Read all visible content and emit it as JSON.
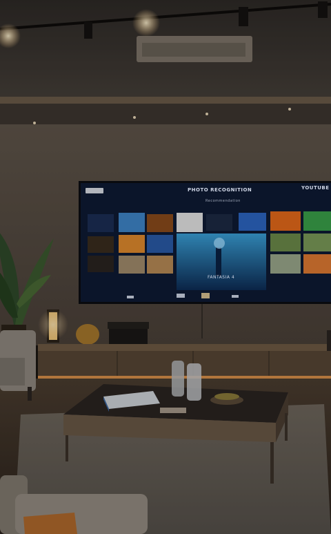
{
  "tv": {
    "brand_text": "PHOTO RECOGNITION",
    "right_text": "YOUTUBE",
    "sub_text": "Recommendation",
    "hero_caption": "FANTASIA 4"
  },
  "colors": {
    "wall": "#5a5148",
    "ceiling": "#3e3833",
    "floor": "#2f2720",
    "coffee_table_top": "#2a2420",
    "screen": "#0e1a34",
    "warm_light": "#ffcf8a"
  }
}
